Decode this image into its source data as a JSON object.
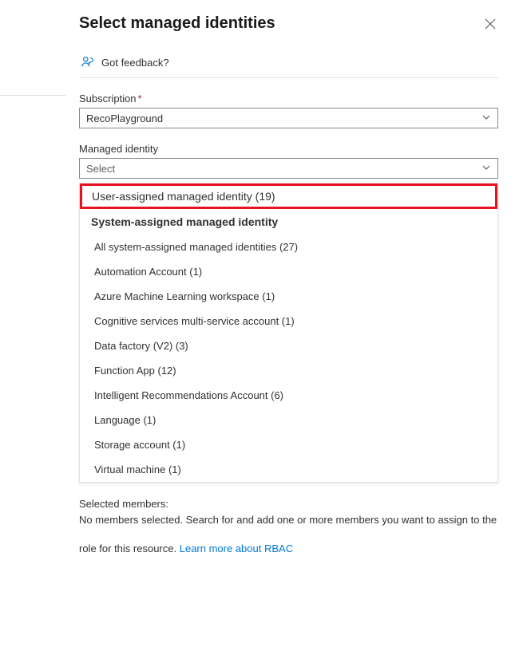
{
  "title": "Select managed identities",
  "feedback_label": "Got feedback?",
  "subscription": {
    "label": "Subscription",
    "value": "RecoPlayground"
  },
  "managed_identity": {
    "label": "Managed identity",
    "placeholder": "Select"
  },
  "dropdown": {
    "user_assigned": "User-assigned managed identity (19)",
    "system_assigned_header": "System-assigned managed identity",
    "items": [
      "All system-assigned managed identities (27)",
      "Automation Account (1)",
      "Azure Machine Learning workspace (1)",
      "Cognitive services multi-service account (1)",
      "Data factory (V2) (3)",
      "Function App (12)",
      "Intelligent Recommendations Account (6)",
      "Language (1)",
      "Storage account (1)",
      "Virtual machine (1)"
    ]
  },
  "selected": {
    "label": "Selected members:",
    "message": "No members selected. Search for and add one or more members you want to assign to the role for this resource."
  },
  "learn_more": "Learn more about RBAC"
}
